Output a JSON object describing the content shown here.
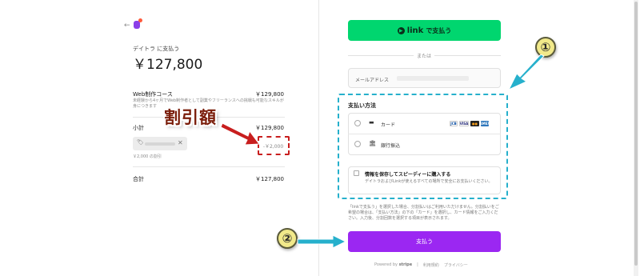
{
  "merchant": {
    "back_arrow": "←",
    "pay_to": "デイトラ に支払う",
    "amount": "￥127,800"
  },
  "order": {
    "item_name": "Web制作コース",
    "item_price": "￥129,800",
    "item_desc": "未経験から4ヶ月でWeb制作者として副業やフリーランスへの挑戦も可能なスキルが身につきます",
    "subtotal_label": "小計",
    "subtotal_price": "￥129,800",
    "coupon_icon": "tag-icon",
    "coupon_remove": "✕",
    "coupon_sub": "￥2,000 の割引",
    "discount_value": "-￥2,000",
    "total_label": "合計",
    "total_price": "￥127,800"
  },
  "annotations": {
    "discount_label": "割引額",
    "step1": "①",
    "step2": "②",
    "accent_red": "#c81e1e",
    "accent_cyan": "#26b0cc"
  },
  "checkout": {
    "link_button_label": "で支払う",
    "link_word": "link",
    "or_text": "または",
    "email_label": "メールアドレス",
    "payment_method_title": "支払い方法",
    "methods": [
      {
        "icon": "card-icon",
        "label": "カード"
      },
      {
        "icon": "bank-icon",
        "label": "銀行振込"
      }
    ],
    "card_brands": [
      "JCB",
      "VISA",
      "MC",
      "AMEX"
    ],
    "save_title": "情報を保存してスピーディーに購入する",
    "save_desc": "デイトラおよびLinkが使えるすべての場所で安全にお支払いください。",
    "note": "「linkで支払う」を選択した場合、分割払いはご利用いただけません。分割払いをご希望の場合は、「支払い方法」の下の「カード」を選択し、カード情報をご入力ください。入力後、分割回数を選択する項目が表示されます。",
    "pay_button_label": "支払う",
    "pay_button_color": "#9b27f2",
    "link_button_color": "#00d66f"
  },
  "footer": {
    "powered_by": "Powered by",
    "brand": "stripe",
    "terms": "利用規約",
    "privacy": "プライバシー"
  }
}
